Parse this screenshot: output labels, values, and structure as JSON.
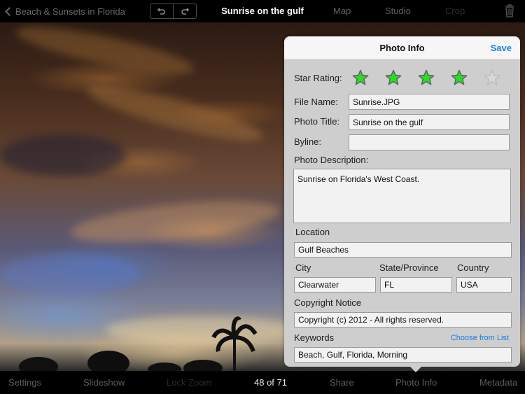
{
  "topbar": {
    "back_label": "Beach & Sunsets in Florida",
    "undo_icon": "undo-arrow",
    "redo_icon": "redo-arrow",
    "title": "Sunrise on the gulf",
    "tabs": [
      {
        "label": "Map",
        "enabled": true
      },
      {
        "label": "Studio",
        "enabled": true
      },
      {
        "label": "Crop",
        "enabled": false
      }
    ],
    "trash_icon": "trash-icon"
  },
  "popover": {
    "title": "Photo Info",
    "save_label": "Save",
    "star_rating": {
      "label": "Star Rating:",
      "value": 4,
      "max": 5,
      "filled_color": "#22e022",
      "empty_color": "#d8d8d8"
    },
    "fields": {
      "file_name": {
        "label": "File Name:",
        "value": "Sunrise.JPG"
      },
      "photo_title": {
        "label": "Photo Title:",
        "value": "Sunrise on the gulf"
      },
      "byline": {
        "label": "Byline:",
        "value": ""
      },
      "description": {
        "label": "Photo Description:",
        "value": "Sunrise on Florida's West Coast."
      },
      "location": {
        "label": "Location",
        "value": "Gulf Beaches"
      },
      "city": {
        "label": "City",
        "value": "Clearwater"
      },
      "state": {
        "label": "State/Province",
        "value": "FL"
      },
      "country": {
        "label": "Country",
        "value": "USA"
      },
      "copyright": {
        "label": "Copyright Notice",
        "value": "Copyright (c) 2012 - All rights reserved."
      },
      "keywords": {
        "label": "Keywords",
        "value": "Beach, Gulf, Florida, Morning",
        "choose_link": "Choose from List"
      }
    }
  },
  "bottombar": {
    "items": [
      {
        "label": "Settings",
        "enabled": true
      },
      {
        "label": "Slideshow",
        "enabled": true
      },
      {
        "label": "Lock Zoom",
        "enabled": false
      },
      {
        "label": "Share",
        "enabled": true
      },
      {
        "label": "Photo Info",
        "enabled": true,
        "active": true
      },
      {
        "label": "Metadata",
        "enabled": true
      }
    ],
    "counter": "48 of 71"
  },
  "colors": {
    "accent": "#1a7de0",
    "toolbar_bg": "#000000",
    "popover_bg": "#cecece",
    "field_bg": "#f2f2f2"
  }
}
